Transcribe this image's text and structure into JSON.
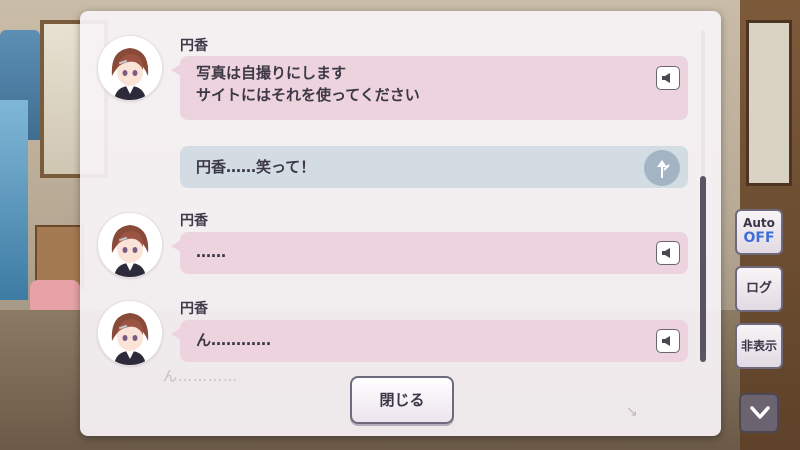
{
  "log": {
    "entries": [
      {
        "speaker": "円香",
        "lines": [
          "写真は自撮りにします",
          "サイトにはそれを使ってください"
        ]
      },
      {
        "speaker": "円香",
        "lines": [
          "……"
        ]
      },
      {
        "speaker": "円香",
        "lines": [
          "ん…………"
        ]
      }
    ],
    "choice": "円香……笑って！",
    "background_residual": "ん…………",
    "close_label": "閉じる"
  },
  "side_menu": {
    "auto_label": "Auto",
    "auto_state": "OFF",
    "log_label": "ログ",
    "hide_label": "非表示"
  },
  "icons": {
    "voice": "speaker-icon",
    "choice": "branch-arrow-icon",
    "down": "chevron-down-icon"
  },
  "colors": {
    "bubble": "#edd3dd",
    "choice_bubble": "#d3dbe3",
    "panel": "#f8f3f6",
    "auto_off": "#3d6fd6"
  }
}
